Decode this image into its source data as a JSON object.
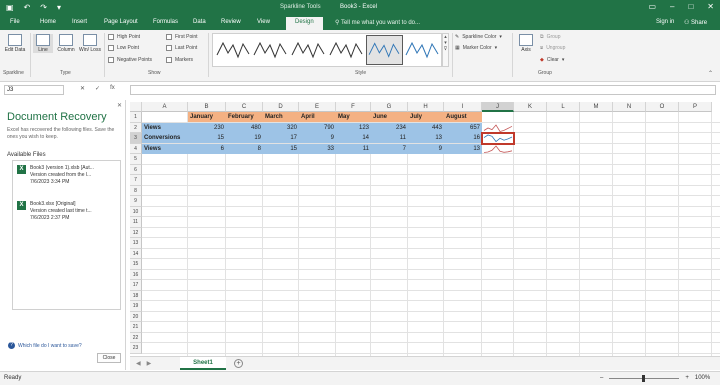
{
  "titlebar": {
    "context_label": "Sparkline Tools",
    "document_title": "Book3 - Excel",
    "quick_access": [
      "save",
      "undo",
      "redo",
      "customize"
    ]
  },
  "tabs": {
    "items": [
      {
        "label": "File",
        "left": 0
      },
      {
        "label": "Home",
        "left": 0
      },
      {
        "label": "Insert",
        "left": 0
      },
      {
        "label": "Page Layout",
        "left": 0
      },
      {
        "label": "Formulas",
        "left": 0
      },
      {
        "label": "Data",
        "left": 0
      },
      {
        "label": "Review",
        "left": 0
      },
      {
        "label": "View",
        "left": 0
      }
    ],
    "active": "Design",
    "tell_me": "Tell me what you want to do...",
    "sign_in": "Sign in",
    "share": "Share"
  },
  "ribbon": {
    "edit_data": "Edit Data",
    "line": "Line",
    "column": "Column",
    "winloss": "Win/ Loss",
    "show": [
      "High Point",
      "Low Point",
      "Negative Points",
      "First Point",
      "Last Point",
      "Markers"
    ],
    "sparkline_color": "Sparkline Color",
    "marker_color": "Marker Color",
    "axis": "Axis",
    "group": "Group",
    "ungroup": "Ungroup",
    "clear": "Clear",
    "group_labels": {
      "sparkline": "Sparkline",
      "type": "Type",
      "show": "Show",
      "style": "Style",
      "group": "Group"
    }
  },
  "formula_bar": {
    "name_box": "J3",
    "cancel": "✕",
    "enter": "✓",
    "fx": "fx",
    "value": ""
  },
  "recovery": {
    "title": "Document Recovery",
    "description": "Excel has recovered the following files. Save the ones you wish to keep.",
    "available_files": "Available Files",
    "files": [
      {
        "name": "Book3 (version 1).xlsb [Aut...",
        "line2": "Version created from the l...",
        "date": "7/6/2023 3:34 PM"
      },
      {
        "name": "Book3.xlsx [Original]",
        "line2": "Version created last time t...",
        "date": "7/6/2023 2:37 PM"
      }
    ],
    "which_file": "Which file do I want to save?",
    "close": "Close"
  },
  "sheet": {
    "columns": [
      "A",
      "B",
      "C",
      "D",
      "E",
      "F",
      "G",
      "H",
      "I",
      "J",
      "K",
      "L",
      "M",
      "N",
      "O",
      "P"
    ],
    "rows": [
      "1",
      "2",
      "3",
      "4",
      "5",
      "6",
      "7",
      "8",
      "9",
      "10",
      "11",
      "12",
      "13",
      "14",
      "15",
      "16",
      "17",
      "18",
      "19",
      "20",
      "21",
      "22",
      "23"
    ],
    "headers": [
      "January",
      "February",
      "March",
      "April",
      "May",
      "June",
      "July",
      "August"
    ],
    "data_rows": [
      {
        "label": "Views",
        "values": [
          "230",
          "480",
          "320",
          "790",
          "123",
          "234",
          "443",
          "657"
        ]
      },
      {
        "label": "Conversions",
        "values": [
          "15",
          "19",
          "17",
          "9",
          "14",
          "11",
          "13",
          "16"
        ]
      },
      {
        "label": "Views",
        "values": [
          "6",
          "8",
          "15",
          "33",
          "11",
          "7",
          "9",
          "13"
        ]
      }
    ],
    "active_cell": "J3",
    "sheet_tab": "Sheet1"
  },
  "status": {
    "ready": "Ready",
    "zoom": "100%"
  }
}
